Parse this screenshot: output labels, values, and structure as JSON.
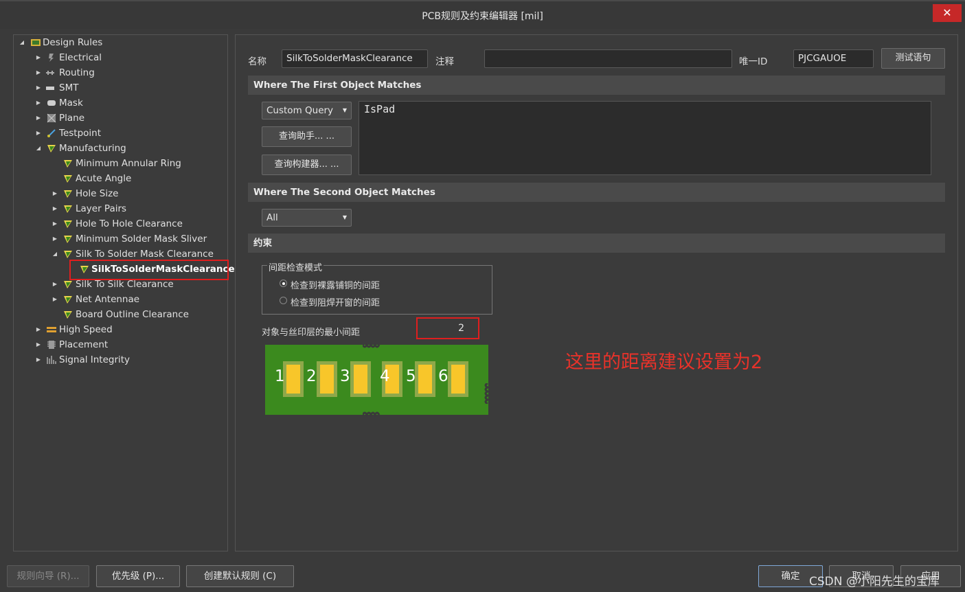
{
  "window": {
    "title": "PCB规则及约束编辑器 [mil]",
    "close_glyph": "✕"
  },
  "tree": {
    "root": "Design Rules",
    "categories": {
      "electrical": "Electrical",
      "routing": "Routing",
      "smt": "SMT",
      "mask": "Mask",
      "plane": "Plane",
      "testpoint": "Testpoint",
      "manufacturing": "Manufacturing",
      "high_speed": "High Speed",
      "placement": "Placement",
      "signal_integrity": "Signal Integrity"
    },
    "manufacturing_items": {
      "min_annular_ring": "Minimum Annular Ring",
      "acute_angle": "Acute Angle",
      "hole_size": "Hole Size",
      "layer_pairs": "Layer Pairs",
      "hole_to_hole": "Hole To Hole Clearance",
      "min_solder_mask_sliver": "Minimum Solder Mask Sliver",
      "silk_to_solder_mask": "Silk To Solder Mask Clearance",
      "selected_rule": "SilkToSolderMaskClearance*",
      "silk_to_silk": "Silk To Silk Clearance",
      "net_antennae": "Net Antennae",
      "board_outline": "Board Outline Clearance"
    },
    "icon_names": [
      "design-rules-icon",
      "electrical-icon",
      "routing-icon",
      "smt-icon",
      "mask-icon",
      "plane-icon",
      "testpoint-icon",
      "manufacturing-rule-icon",
      "high-speed-icon",
      "placement-icon",
      "signal-integrity-icon"
    ]
  },
  "rule": {
    "name_label": "名称",
    "name_value": "SilkToSolderMaskClearance",
    "comment_label": "注释",
    "comment_value": "",
    "uid_label": "唯一ID",
    "uid_value": "PJCGAUOE",
    "test_button": "测试语句"
  },
  "first_match": {
    "header": "Where The First Object Matches",
    "query_type": "Custom Query",
    "helper_button": "查询助手... ...",
    "builder_button": "查询构建器... ...",
    "query_text": "IsPad"
  },
  "second_match": {
    "header": "Where The Second Object Matches",
    "query_type": "All"
  },
  "constraints": {
    "header": "约束",
    "mode_group_title": "间距检查模式",
    "option_exposed_copper": "检查到裸露铺铜的间距",
    "option_solder_mask_opening": "检查到阻焊开窗的间距",
    "selected_option": "检查到裸露铺铜的间距",
    "min_clearance_label": "对象与丝印层的最小间距",
    "min_clearance_value": "2",
    "pad_numbers": [
      "1",
      "2",
      "3",
      "4",
      "5",
      "6"
    ],
    "annotation": "这里的距离建议设置为2",
    "colors": {
      "board": "#3b8a1e",
      "pad": "#f8c62a",
      "highlight": "#e01e1e"
    }
  },
  "footer": {
    "wizard_button": "规则向导 (R)...",
    "priority_button": "优先级 (P)...",
    "create_default_button": "创建默认规则 (C)",
    "ok_button": "确定",
    "cancel_button": "取消",
    "apply_button": "应用",
    "watermark": "CSDN @小阳先生的宝库"
  }
}
